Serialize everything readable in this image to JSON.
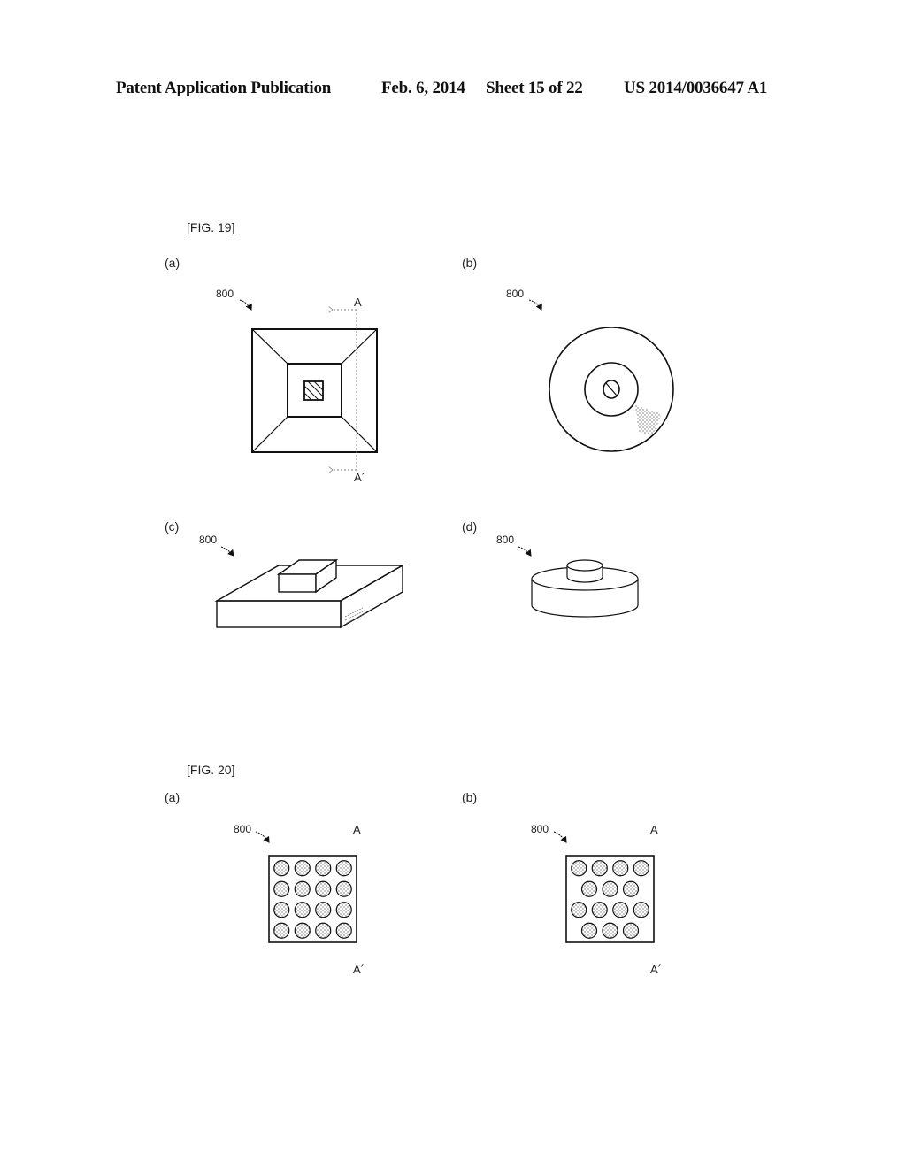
{
  "header": {
    "publication": "Patent Application Publication",
    "date": "Feb. 6, 2014",
    "sheet": "Sheet 15 of 22",
    "number": "US 2014/0036647 A1"
  },
  "fig19": {
    "title": "[FIG. 19]",
    "panels": {
      "a": {
        "label": "(a)",
        "ref": "800",
        "section_top": "A",
        "section_bottom": "A´"
      },
      "b": {
        "label": "(b)",
        "ref": "800"
      },
      "c": {
        "label": "(c)",
        "ref": "800"
      },
      "d": {
        "label": "(d)",
        "ref": "800"
      }
    }
  },
  "fig20": {
    "title": "[FIG. 20]",
    "panels": {
      "a": {
        "label": "(a)",
        "ref": "800",
        "section_top": "A",
        "section_bottom": "A´",
        "rows": [
          4,
          4,
          4,
          4
        ],
        "arrangement": "square-grid"
      },
      "b": {
        "label": "(b)",
        "ref": "800",
        "section_top": "A",
        "section_bottom": "A´",
        "rows": [
          4,
          3,
          4,
          3
        ],
        "arrangement": "staggered"
      }
    }
  }
}
